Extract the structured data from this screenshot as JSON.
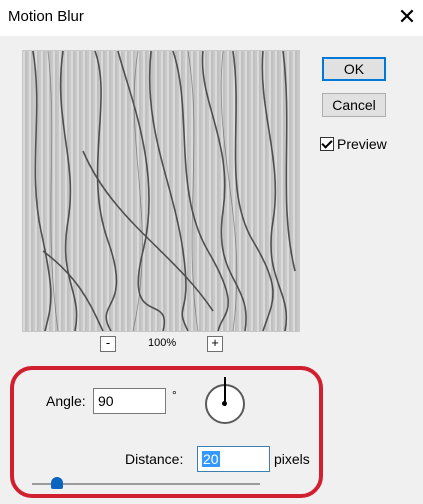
{
  "window": {
    "title": "Motion Blur",
    "close_glyph": "✕"
  },
  "buttons": {
    "ok": "OK",
    "cancel": "Cancel"
  },
  "preview": {
    "checkbox_label": "Preview",
    "checked": true
  },
  "zoom": {
    "minus": "-",
    "plus": "+",
    "level": "100%"
  },
  "angle": {
    "label": "Angle:",
    "value": "90",
    "unit": "°"
  },
  "distance": {
    "label": "Distance:",
    "value": "20",
    "unit": "pixels"
  },
  "slider": {
    "value_fraction": 0.09
  },
  "colors": {
    "accent": "#0078d7",
    "highlight": "#d21f2f",
    "slider": "#0b64c0"
  },
  "icons": [
    "close-icon",
    "checkmark-icon",
    "angle-dial-icon",
    "slider-thumb-icon"
  ]
}
